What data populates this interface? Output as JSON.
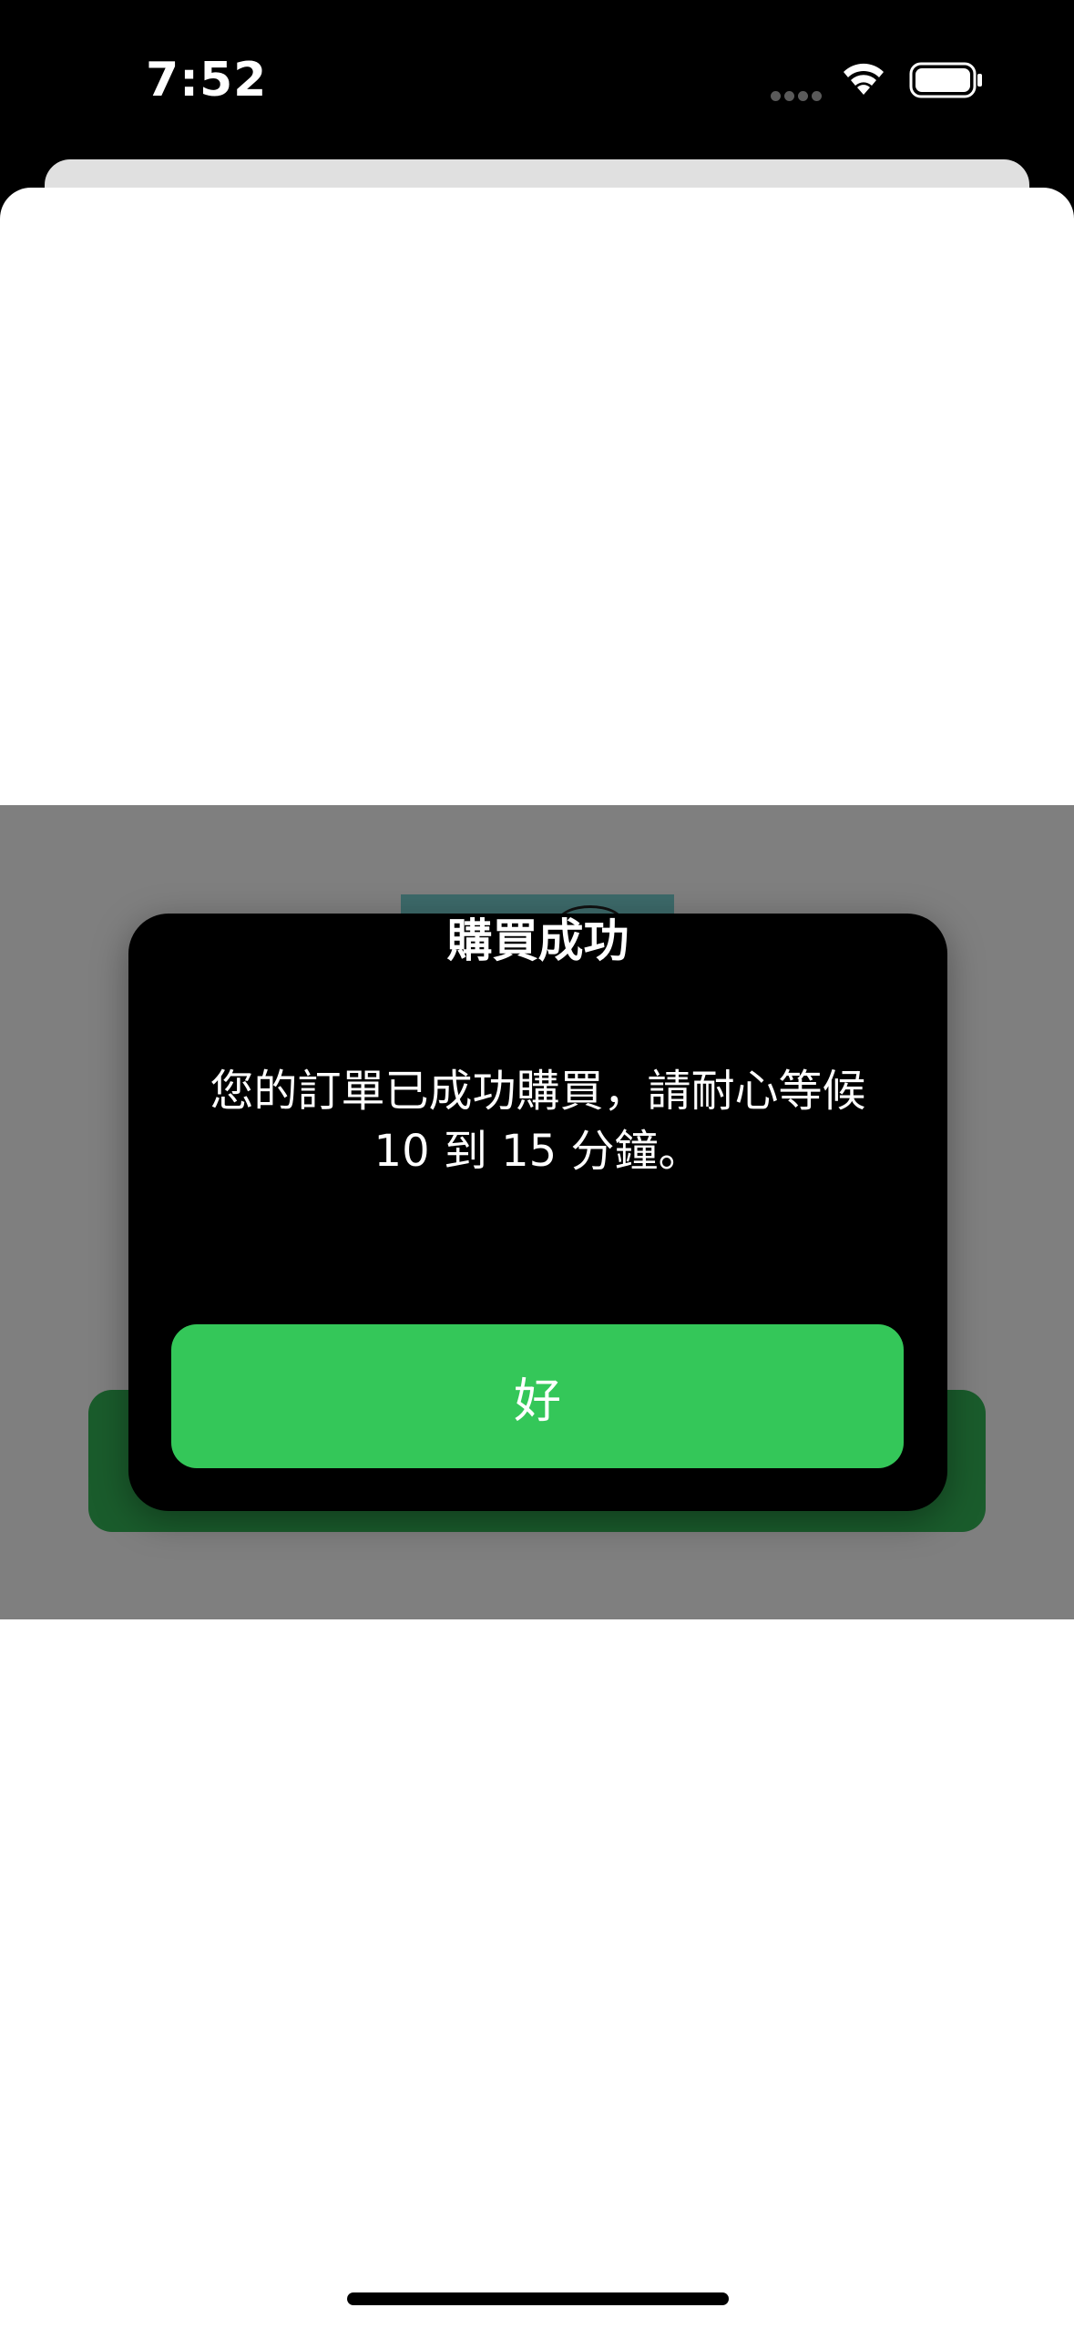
{
  "status_bar": {
    "time": "7:52",
    "icons": [
      "cellular-signal-icon",
      "wifi-icon",
      "battery-icon"
    ]
  },
  "alert": {
    "title": "購買成功",
    "message_line1": "您的訂單已成功購買，請耐心等候",
    "message_line2": "10 到 15 分鐘。",
    "ok_label": "好"
  },
  "colors": {
    "accent_green": "#34c759",
    "dialog_background": "#000000",
    "dim_overlay": "#7f7f7f",
    "status_bar_background": "#000000"
  }
}
